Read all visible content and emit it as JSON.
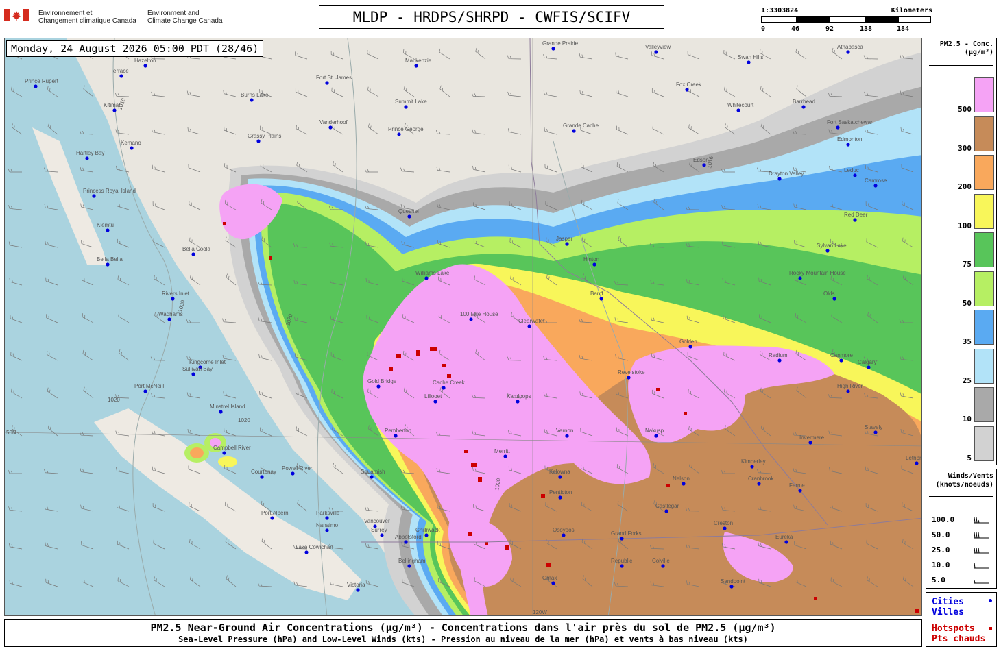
{
  "header": {
    "gov_fr": [
      "Environnement et",
      "Changement climatique Canada"
    ],
    "gov_en": [
      "Environment and",
      "Climate Change Canada"
    ],
    "title": "MLDP - HRDPS/SHRPD - CWFIS/SCIFV",
    "scale": {
      "ratio": "1:3303824",
      "unit": "Kilometers",
      "ticks": [
        "0",
        "46",
        "92",
        "138",
        "184"
      ]
    }
  },
  "map": {
    "timestamp": "Monday, 24 August 2026 05:00 PDT (28/46)",
    "isobar_label": "1020",
    "isobar_label_b": "1016",
    "lat_label": "50N",
    "lon_label": "120W",
    "cities": [
      "Prince Rupert",
      "Terrace",
      "Hazelton",
      "Burns Lake",
      "Fort St. James",
      "Vanderhoof",
      "Prince George",
      "Summit Lake",
      "Kitimat",
      "Kemano",
      "Hartley Bay",
      "Princess Royal Island",
      "Klemtu",
      "Bella Bella",
      "Bella Coola",
      "Quesnel",
      "Williams Lake",
      "100 Mile House",
      "Clearwater",
      "Kamloops",
      "Cache Creek",
      "Lillooet",
      "Merritt",
      "Vernon",
      "Kelowna",
      "Penticton",
      "Osoyoos",
      "Revelstoke",
      "Golden",
      "Nakusp",
      "Nelson",
      "Castlegar",
      "Cranbrook",
      "Fernie",
      "Kimberley",
      "Invermere",
      "Radium",
      "Canmore",
      "Calgary",
      "High River",
      "Stavely",
      "Lethbridge",
      "Edmonton",
      "Red Deer",
      "Olds",
      "Leduc",
      "Drayton Valley",
      "Edson",
      "Grande Cache",
      "Whitecourt",
      "Fox Creek",
      "Swan Hills",
      "Athabasca",
      "Barrhead",
      "Fort Saskatchewan",
      "Camrose",
      "Vancouver",
      "Surrey",
      "Abbotsford",
      "Chilliwack",
      "Squamish",
      "Powell River",
      "Campbell River",
      "Courtenay",
      "Port Alberni",
      "Parksville",
      "Nanaimo",
      "Lake Cowichan",
      "Victoria",
      "Bellingham",
      "Gold Bridge",
      "Pemberton",
      "Port McNeill",
      "Kingcome Inlet",
      "Sullivan Bay",
      "Minstrel Island",
      "Wadhams",
      "Rivers Inlet",
      "Grand Forks",
      "Republic",
      "Colville",
      "Omak",
      "Sandpoint",
      "Eureka",
      "Creston",
      "Valleyview",
      "Grande Prairie",
      "Jasper",
      "Hinton",
      "Rocky Mountain House",
      "Sylvan Lake",
      "Banff",
      "Mackenzie",
      "Grassy Plains"
    ]
  },
  "legend": {
    "title": "PM2.5 - Conc.",
    "unit": "(µg/m³)",
    "levels": [
      {
        "label": "500",
        "color": "#f5a3f5"
      },
      {
        "label": "300",
        "color": "#c68b59"
      },
      {
        "label": "200",
        "color": "#f9a85c"
      },
      {
        "label": "100",
        "color": "#f8f65a"
      },
      {
        "label": "75",
        "color": "#58c55a"
      },
      {
        "label": "50",
        "color": "#b6ef63"
      },
      {
        "label": "35",
        "color": "#5aaaf2"
      },
      {
        "label": "25",
        "color": "#b2e3f8"
      },
      {
        "label": "10",
        "color": "#a9a9a9"
      },
      {
        "label": "5",
        "color": "#d2d2d2"
      }
    ]
  },
  "winds": {
    "title": "Winds/Vents",
    "unit": "(knots/noeuds)",
    "rows": [
      "100.0",
      "50.0",
      "25.0",
      "10.0",
      "5.0"
    ]
  },
  "key": {
    "cities": "Cities",
    "villes": "Villes",
    "hotspots": "Hotspots",
    "pts": "Pts chauds",
    "city_color": "#0000dd",
    "hotspot_color": "#cc0000"
  },
  "caption": {
    "line1": "PM2.5 Near-Ground Air Concentrations (µg/m³) - Concentrations dans l'air près du sol de PM2.5 (µg/m³)",
    "line2": "Sea-Level Pressure (hPa) and Low-Level Winds (kts) - Pression au niveau de la mer (hPa) et vents à bas niveau (kts)"
  }
}
